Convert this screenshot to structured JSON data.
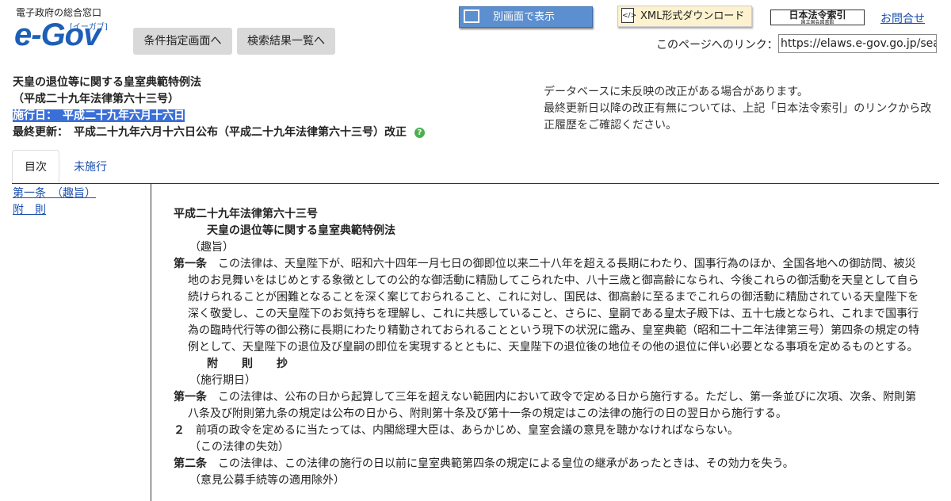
{
  "logo": {
    "top_text": "電子政府の総合窓口",
    "main": "e-Gov",
    "sub": "[イーガブ]"
  },
  "nav": {
    "condition_button": "条件指定画面へ",
    "results_button": "検索結果一覧へ"
  },
  "toolbar": {
    "separate_window": "別画面で表示",
    "xml_download": "XML形式ダウンロード",
    "law_index": "日本法令索引",
    "law_index_sub": "国立国会図書館",
    "contact": "お問合せ",
    "page_link_label": "このページへのリンク：",
    "page_link_url": "https://elaws.e-gov.go.jp/search"
  },
  "law": {
    "title": "天皇の退位等に関する皇室典範特例法",
    "number": "（平成二十九年法律第六十三号）",
    "effective_label": "施行日：",
    "effective_date": "平成二十九年六月十六日",
    "updated_label": "最終更新：",
    "updated_value": "平成二十九年六月十六日公布（平成二十九年法律第六十三号）改正"
  },
  "notice": {
    "line1": "データベースに未反映の改正がある場合があります。",
    "line2": "最終更新日以降の改正有無については、上記「日本法令索引」のリンクから改正履歴をご確認ください。"
  },
  "tabs": {
    "toc": "目次",
    "not_enforced": "未施行"
  },
  "toc": {
    "item1": "第一条　（趣旨）",
    "item2": "附　則"
  },
  "body": {
    "law_no": "平成二十九年法律第六十三号",
    "law_title": "天皇の退位等に関する皇室典範特例法",
    "cap1": "（趣旨）",
    "art1_label": "第一条",
    "art1_text": "この法律は、天皇陛下が、昭和六十四年一月七日の御即位以来二十八年を超える長期にわたり、国事行為のほか、全国各地への御訪問、被災地のお見舞いをはじめとする象徴としての公的な御活動に精励してこられた中、八十三歳と御高齢になられ、今後これらの御活動を天皇として自ら続けられることが困難となることを深く案じておられること、これに対し、国民は、御高齢に至るまでこれらの御活動に精励されている天皇陛下を深く敬愛し、この天皇陛下のお気持ちを理解し、これに共感していること、さらに、皇嗣である皇太子殿下は、五十七歳となられ、これまで国事行為の臨時代行等の御公務に長期にわたり精勤されておられることという現下の状況に鑑み、皇室典範（昭和二十二年法律第三号）第四条の規定の特例として、天皇陛下の退位及び皇嗣の即位を実現するとともに、天皇陛下の退位後の地位その他の退位に伴い必要となる事項を定めるものとする。",
    "suppl_head": "附　則　抄",
    "cap2": "（施行期日）",
    "s_art1_label": "第一条",
    "s_art1_text": "この法律は、公布の日から起算して三年を超えない範囲内において政令で定める日から施行する。ただし、第一条並びに次項、次条、附則第八条及び附則第九条の規定は公布の日から、附則第十条及び第十一条の規定はこの法律の施行の日の翌日から施行する。",
    "s_para2_label": "２",
    "s_para2_text": "前項の政令を定めるに当たっては、内閣総理大臣は、あらかじめ、皇室会議の意見を聴かなければならない。",
    "cap3": "（この法律の失効）",
    "s_art2_label": "第二条",
    "s_art2_text": "この法律は、この法律の施行の日以前に皇室典範第四条の規定による皇位の継承があったときは、その効力を失う。",
    "cap4": "（意見公募手続等の適用除外）"
  }
}
